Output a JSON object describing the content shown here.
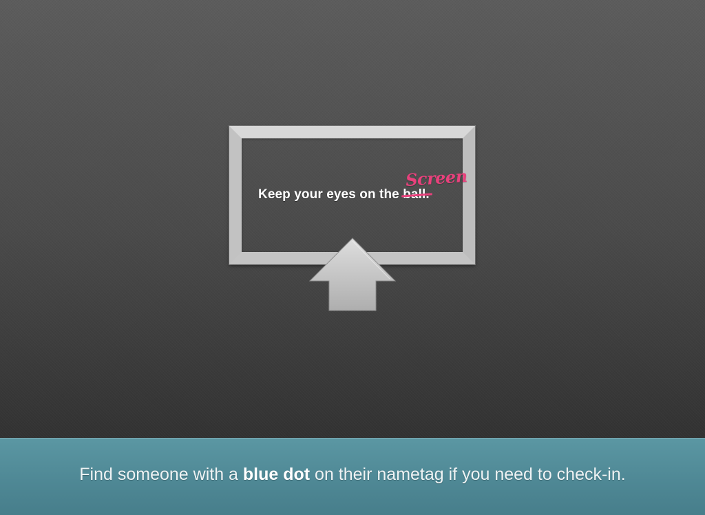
{
  "screen": {
    "prefix": "Keep your eyes on the ",
    "struck_word": "ball.",
    "replacement_word": "Screen"
  },
  "footer": {
    "before": "Find someone with a ",
    "emphasis": "blue dot",
    "after": " on their nametag if you need to check-in."
  },
  "colors": {
    "accent_pink": "#e8417c",
    "footer_bg": "#4e8794",
    "frame": "#c9c9c9"
  },
  "icons": {
    "frame": "screen-frame-icon",
    "arrow": "up-arrow-icon"
  }
}
